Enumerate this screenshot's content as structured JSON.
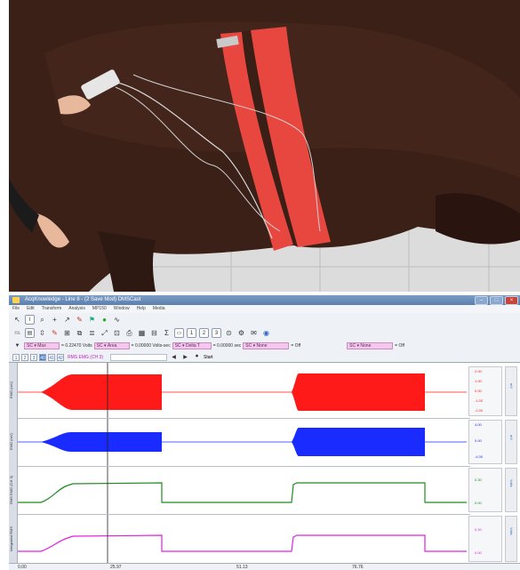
{
  "app": {
    "title": "AcqKnowledge - Line 8 - (2 Save Mod) DMSCast",
    "menu": [
      "File",
      "Edit",
      "Transform",
      "Analysis",
      "MP150",
      "Window",
      "Help",
      "Media"
    ],
    "window_buttons": [
      "Minimize",
      "Maximize",
      "Close"
    ]
  },
  "toolbar": {
    "icons": [
      "arrow-cursor-icon",
      "ibeam-cursor-icon",
      "zoom-icon",
      "crosshair-icon",
      "marker-icon",
      "pencil-icon",
      "flag-icon",
      "dot-icon",
      "wave-icon"
    ],
    "icons2": [
      "nav-icon",
      "channel-icon",
      "scale-icon",
      "edit-icon",
      "grid-icon",
      "overlap-icon",
      "stack-icon",
      "autoscale-icon",
      "zoom-fit-icon",
      "print-icon",
      "table-icon",
      "calc-icon",
      "sum-icon",
      "measure-icon",
      "a-icon",
      "b-icon",
      "c-icon",
      "d-icon",
      "settings-icon",
      "comment-icon",
      "camera-icon"
    ]
  },
  "measurements": {
    "m1": {
      "channel": "SC",
      "func": "Max",
      "value": "0.22470",
      "unit": "Volts"
    },
    "m2": {
      "channel": "SC",
      "func": "Area",
      "value": "0.00000",
      "unit": "Volts-sec"
    },
    "m3": {
      "channel": "SC",
      "func": "Delta T",
      "value": "0.00000",
      "unit": "sec"
    },
    "m4": {
      "channel": "SC",
      "func": "None",
      "value": "Off"
    },
    "m5": {
      "channel": "SC",
      "func": "None",
      "value": "Off"
    }
  },
  "channel_row": {
    "buttons": [
      "1",
      "2",
      "3",
      "40",
      "41",
      "42"
    ],
    "selected_index": 3,
    "label": "RMS EMG (CH 3)",
    "start_label": "Start"
  },
  "channels": [
    {
      "label": "EMG (mV)",
      "ticks": [
        "2.00",
        "1.00",
        "0.00",
        "-1.00",
        "-2.00"
      ],
      "unit": "mV",
      "color": "#ff1a1a"
    },
    {
      "label": "EMG (mV)",
      "ticks": [
        "4.00",
        "0.00",
        "-4.00"
      ],
      "unit": "mV",
      "color": "#1a2bff"
    },
    {
      "label": "RMS EMG (CH 3)",
      "ticks": [
        "0.30",
        "0.00"
      ],
      "unit": "Volts",
      "color": "#1f8a1f"
    },
    {
      "label": "Integrated RMS",
      "ticks": [
        "0.20",
        "0.00"
      ],
      "unit": "Volts",
      "color": "#e020e0"
    }
  ],
  "time_axis": {
    "ticks": [
      "0.00",
      "25.97",
      "51.13",
      "76.76"
    ],
    "unit": "sec"
  },
  "colors": {
    "emg1": "#ff1a1a",
    "emg2": "#1a2bff",
    "rms": "#1f8a1f",
    "int": "#e020e0",
    "strap": "#e8473f",
    "horse": "#3a1f17"
  }
}
